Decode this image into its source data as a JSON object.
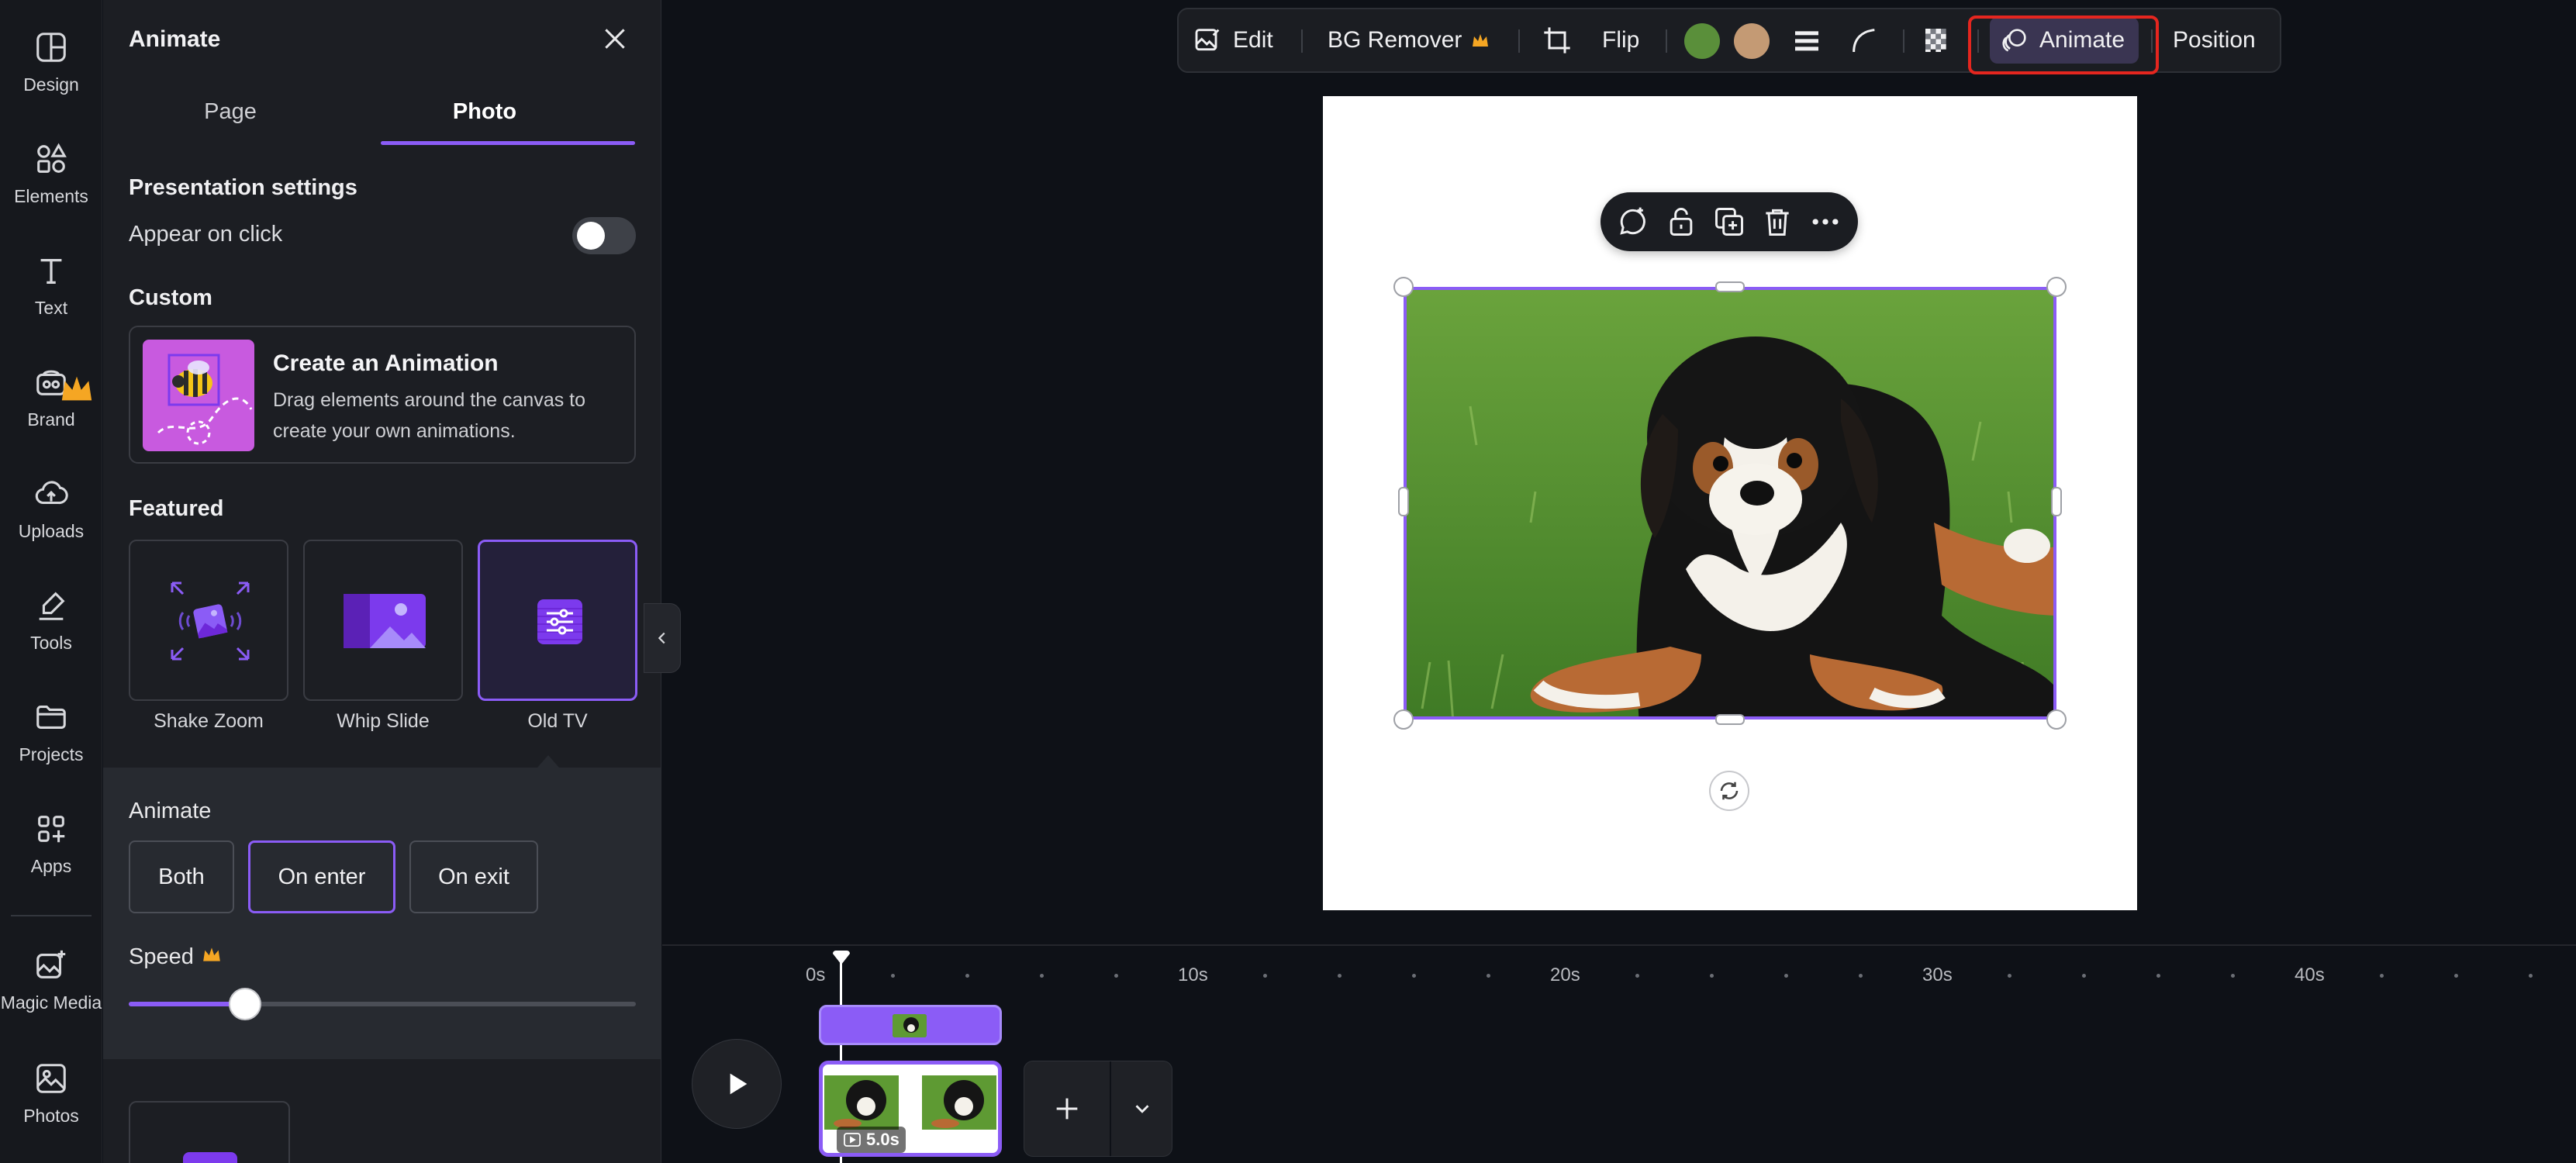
{
  "sidebar": {
    "items": [
      {
        "label": "Design",
        "icon": "design-icon"
      },
      {
        "label": "Elements",
        "icon": "elements-icon"
      },
      {
        "label": "Text",
        "icon": "text-icon"
      },
      {
        "label": "Brand",
        "icon": "brand-icon",
        "premium": true
      },
      {
        "label": "Uploads",
        "icon": "cloud-upload-icon"
      },
      {
        "label": "Tools",
        "icon": "pen-tool-icon"
      },
      {
        "label": "Projects",
        "icon": "folder-icon"
      },
      {
        "label": "Apps",
        "icon": "apps-grid-icon"
      },
      {
        "label": "Magic Media",
        "icon": "magic-image-icon"
      },
      {
        "label": "Photos",
        "icon": "photo-icon"
      }
    ]
  },
  "panel": {
    "title": "Animate",
    "tabs": [
      {
        "label": "Page",
        "active": false
      },
      {
        "label": "Photo",
        "active": true
      }
    ],
    "presentation": {
      "heading": "Presentation settings",
      "appear_on_click": {
        "label": "Appear on click",
        "on": false
      }
    },
    "custom": {
      "heading": "Custom",
      "card_title": "Create an Animation",
      "card_desc": "Drag elements around the canvas to create your own animations."
    },
    "featured": {
      "heading": "Featured",
      "items": [
        {
          "label": "Shake Zoom",
          "icon": "shake-zoom-icon",
          "selected": false
        },
        {
          "label": "Whip Slide",
          "icon": "whip-slide-icon",
          "selected": false
        },
        {
          "label": "Old TV",
          "icon": "old-tv-icon",
          "selected": true
        }
      ]
    },
    "options": {
      "heading": "Animate",
      "modes": [
        "Both",
        "On enter",
        "On exit"
      ],
      "selected_mode": "On enter",
      "speed_label": "Speed",
      "speed_premium": true,
      "speed_value": 0.23
    }
  },
  "toolbar": {
    "edit": "Edit",
    "bg_remover": "BG Remover",
    "flip": "Flip",
    "swatches": [
      "#5a8f3a",
      "#c49a74"
    ],
    "animate": "Animate",
    "position": "Position"
  },
  "colors": {
    "accent": "#8b5cf6",
    "highlight": "#e5261f",
    "crown": "#f5a623"
  },
  "timeline": {
    "ticks": [
      "0s",
      "10s",
      "20s",
      "30s",
      "40s"
    ],
    "clip_duration": "5.0s"
  }
}
